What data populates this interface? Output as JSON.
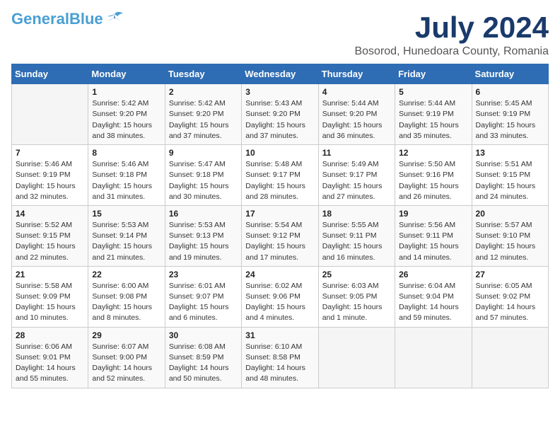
{
  "header": {
    "logo_line1": "General",
    "logo_line2": "Blue",
    "title": "July 2024",
    "location": "Bosorod, Hunedoara County, Romania"
  },
  "weekdays": [
    "Sunday",
    "Monday",
    "Tuesday",
    "Wednesday",
    "Thursday",
    "Friday",
    "Saturday"
  ],
  "weeks": [
    [
      {
        "day": "",
        "info": ""
      },
      {
        "day": "1",
        "info": "Sunrise: 5:42 AM\nSunset: 9:20 PM\nDaylight: 15 hours\nand 38 minutes."
      },
      {
        "day": "2",
        "info": "Sunrise: 5:42 AM\nSunset: 9:20 PM\nDaylight: 15 hours\nand 37 minutes."
      },
      {
        "day": "3",
        "info": "Sunrise: 5:43 AM\nSunset: 9:20 PM\nDaylight: 15 hours\nand 37 minutes."
      },
      {
        "day": "4",
        "info": "Sunrise: 5:44 AM\nSunset: 9:20 PM\nDaylight: 15 hours\nand 36 minutes."
      },
      {
        "day": "5",
        "info": "Sunrise: 5:44 AM\nSunset: 9:19 PM\nDaylight: 15 hours\nand 35 minutes."
      },
      {
        "day": "6",
        "info": "Sunrise: 5:45 AM\nSunset: 9:19 PM\nDaylight: 15 hours\nand 33 minutes."
      }
    ],
    [
      {
        "day": "7",
        "info": "Sunrise: 5:46 AM\nSunset: 9:19 PM\nDaylight: 15 hours\nand 32 minutes."
      },
      {
        "day": "8",
        "info": "Sunrise: 5:46 AM\nSunset: 9:18 PM\nDaylight: 15 hours\nand 31 minutes."
      },
      {
        "day": "9",
        "info": "Sunrise: 5:47 AM\nSunset: 9:18 PM\nDaylight: 15 hours\nand 30 minutes."
      },
      {
        "day": "10",
        "info": "Sunrise: 5:48 AM\nSunset: 9:17 PM\nDaylight: 15 hours\nand 28 minutes."
      },
      {
        "day": "11",
        "info": "Sunrise: 5:49 AM\nSunset: 9:17 PM\nDaylight: 15 hours\nand 27 minutes."
      },
      {
        "day": "12",
        "info": "Sunrise: 5:50 AM\nSunset: 9:16 PM\nDaylight: 15 hours\nand 26 minutes."
      },
      {
        "day": "13",
        "info": "Sunrise: 5:51 AM\nSunset: 9:15 PM\nDaylight: 15 hours\nand 24 minutes."
      }
    ],
    [
      {
        "day": "14",
        "info": "Sunrise: 5:52 AM\nSunset: 9:15 PM\nDaylight: 15 hours\nand 22 minutes."
      },
      {
        "day": "15",
        "info": "Sunrise: 5:53 AM\nSunset: 9:14 PM\nDaylight: 15 hours\nand 21 minutes."
      },
      {
        "day": "16",
        "info": "Sunrise: 5:53 AM\nSunset: 9:13 PM\nDaylight: 15 hours\nand 19 minutes."
      },
      {
        "day": "17",
        "info": "Sunrise: 5:54 AM\nSunset: 9:12 PM\nDaylight: 15 hours\nand 17 minutes."
      },
      {
        "day": "18",
        "info": "Sunrise: 5:55 AM\nSunset: 9:11 PM\nDaylight: 15 hours\nand 16 minutes."
      },
      {
        "day": "19",
        "info": "Sunrise: 5:56 AM\nSunset: 9:11 PM\nDaylight: 15 hours\nand 14 minutes."
      },
      {
        "day": "20",
        "info": "Sunrise: 5:57 AM\nSunset: 9:10 PM\nDaylight: 15 hours\nand 12 minutes."
      }
    ],
    [
      {
        "day": "21",
        "info": "Sunrise: 5:58 AM\nSunset: 9:09 PM\nDaylight: 15 hours\nand 10 minutes."
      },
      {
        "day": "22",
        "info": "Sunrise: 6:00 AM\nSunset: 9:08 PM\nDaylight: 15 hours\nand 8 minutes."
      },
      {
        "day": "23",
        "info": "Sunrise: 6:01 AM\nSunset: 9:07 PM\nDaylight: 15 hours\nand 6 minutes."
      },
      {
        "day": "24",
        "info": "Sunrise: 6:02 AM\nSunset: 9:06 PM\nDaylight: 15 hours\nand 4 minutes."
      },
      {
        "day": "25",
        "info": "Sunrise: 6:03 AM\nSunset: 9:05 PM\nDaylight: 15 hours\nand 1 minute."
      },
      {
        "day": "26",
        "info": "Sunrise: 6:04 AM\nSunset: 9:04 PM\nDaylight: 14 hours\nand 59 minutes."
      },
      {
        "day": "27",
        "info": "Sunrise: 6:05 AM\nSunset: 9:02 PM\nDaylight: 14 hours\nand 57 minutes."
      }
    ],
    [
      {
        "day": "28",
        "info": "Sunrise: 6:06 AM\nSunset: 9:01 PM\nDaylight: 14 hours\nand 55 minutes."
      },
      {
        "day": "29",
        "info": "Sunrise: 6:07 AM\nSunset: 9:00 PM\nDaylight: 14 hours\nand 52 minutes."
      },
      {
        "day": "30",
        "info": "Sunrise: 6:08 AM\nSunset: 8:59 PM\nDaylight: 14 hours\nand 50 minutes."
      },
      {
        "day": "31",
        "info": "Sunrise: 6:10 AM\nSunset: 8:58 PM\nDaylight: 14 hours\nand 48 minutes."
      },
      {
        "day": "",
        "info": ""
      },
      {
        "day": "",
        "info": ""
      },
      {
        "day": "",
        "info": ""
      }
    ]
  ]
}
